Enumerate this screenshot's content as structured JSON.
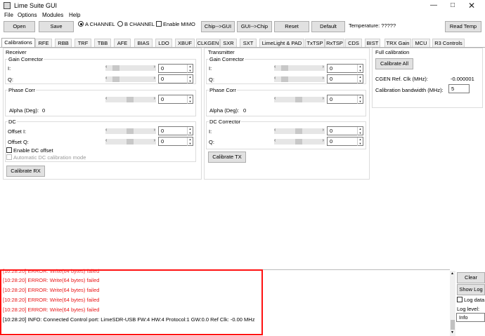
{
  "window": {
    "title": "Lime Suite GUI"
  },
  "menu": [
    "File",
    "Options",
    "Modules",
    "Help"
  ],
  "toolbar": {
    "open": "Open",
    "save": "Save",
    "channel_a": "A CHANNEL",
    "channel_b": "B CHANNEL",
    "enable_mimo": "Enable MIMO",
    "chip_to_gui": "Chip-->GUI",
    "gui_to_chip": "GUI-->Chip",
    "reset": "Reset",
    "default": "Default",
    "temperature": "Temperature: ?????",
    "read_temp": "Read Temp",
    "selected_channel": "A"
  },
  "tabs": [
    "Calibrations",
    "RFE",
    "RBB",
    "TRF",
    "TBB",
    "AFE",
    "BIAS",
    "LDO",
    "XBUF",
    "CLKGEN",
    "SXR",
    "SXT",
    "LimeLight & PAD",
    "TxTSP",
    "RxTSP",
    "CDS",
    "BIST",
    "TRX Gain",
    "MCU",
    "R3 Controls"
  ],
  "active_tab": "Calibrations",
  "receiver": {
    "title": "Receiver",
    "gain_corrector": {
      "title": "Gain Corrector",
      "i_label": "I:",
      "i_value": "0",
      "q_label": "Q:",
      "q_value": "0"
    },
    "phase_corr": {
      "title": "Phase Corr",
      "value": "0",
      "alpha_label": "Alpha (Deg):",
      "alpha_value": "0"
    },
    "dc": {
      "title": "DC",
      "offset_i_label": "Offset I:",
      "offset_i_value": "0",
      "offset_q_label": "Offset Q:",
      "offset_q_value": "0",
      "enable_dc_offset": "Enable DC offset",
      "auto_dc": "Automatic DC calibration mode"
    },
    "calibrate": "Calibrate RX"
  },
  "transmitter": {
    "title": "Transmitter",
    "gain_corrector": {
      "title": "Gain Corrector",
      "i_label": "I:",
      "i_value": "0",
      "q_label": "Q:",
      "q_value": "0"
    },
    "phase_corr": {
      "title": "Phase Corr",
      "value": "0",
      "alpha_label": "Alpha (Deg):",
      "alpha_value": "0"
    },
    "dc_corrector": {
      "title": "DC Corrector",
      "i_label": "I:",
      "i_value": "0",
      "q_label": "Q:",
      "q_value": "0"
    },
    "calibrate": "Calibrate TX"
  },
  "full_calibration": {
    "title": "Full calibration",
    "calibrate_all": "Calibrate All",
    "cgen_label": "CGEN Ref. Clk (MHz):",
    "cgen_value": "-0.000001",
    "bandwidth_label": "Calibration bandwidth (MHz):",
    "bandwidth_value": "5"
  },
  "log": {
    "lines": [
      {
        "text": "[10:28:20] ERROR: Write(64 bytes) failed",
        "type": "error"
      },
      {
        "text": "[10:28:20] ERROR: Write(64 bytes) failed",
        "type": "error"
      },
      {
        "text": "[10:28:20] ERROR: Write(64 bytes) failed",
        "type": "error"
      },
      {
        "text": "[10:28:20] ERROR: Write(64 bytes) failed",
        "type": "error"
      },
      {
        "text": "[10:28:20] INFO: Connected Control port: LimeSDR-USB FW:4 HW:4 Protocol:1 GW:0.0 Ref Clk: -0.00 MHz",
        "type": "info"
      }
    ],
    "clear": "Clear",
    "show_log": "Show Log",
    "log_data": "Log data",
    "log_level_label": "Log level:",
    "log_level_value": "Info"
  },
  "colors": {
    "error": "#e8191a",
    "highlight_box": "#ff1010",
    "info": "#000000"
  }
}
